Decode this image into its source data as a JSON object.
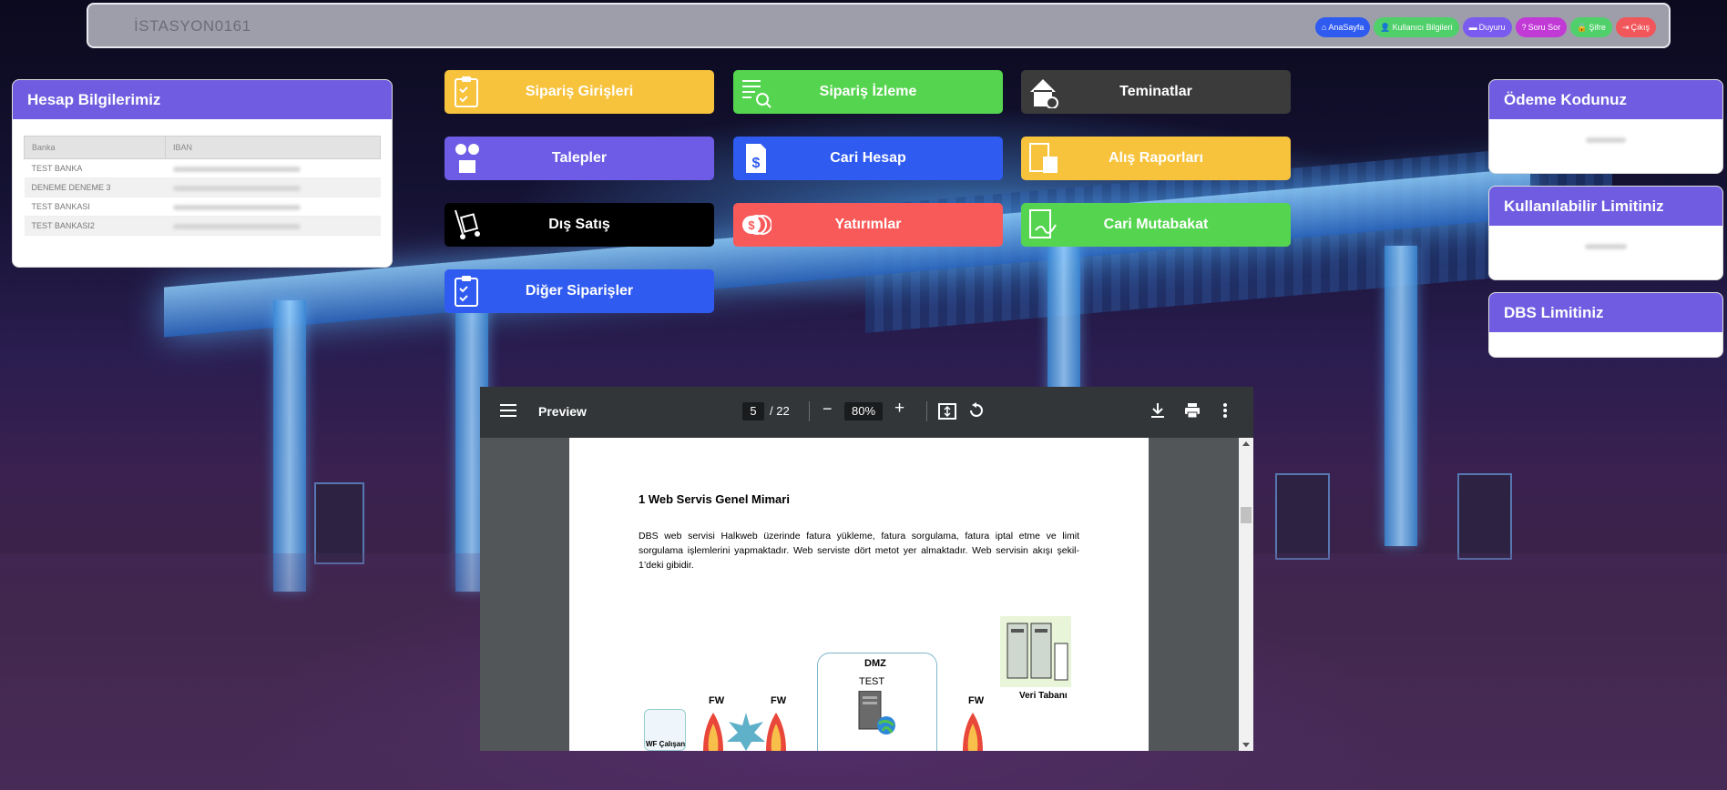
{
  "header": {
    "station": "İSTASYON0161",
    "nav": [
      {
        "label": "AnaSayfa",
        "icon": "home-icon",
        "color": "#2f5bf0"
      },
      {
        "label": "Kullanıcı Bilgileri",
        "icon": "user-icon",
        "color": "#4fd06a"
      },
      {
        "label": "Duyuru",
        "icon": "folder-icon",
        "color": "#7a5bf0"
      },
      {
        "label": "Soru Sor",
        "icon": "question-icon",
        "color": "#c13ad6"
      },
      {
        "label": "Şifre",
        "icon": "lock-icon",
        "color": "#4fd06a"
      },
      {
        "label": "Çıkış",
        "icon": "logout-icon",
        "color": "#f0565a"
      }
    ]
  },
  "account": {
    "title": "Hesap Bilgilerimiz",
    "columns": [
      "Banka",
      "IBAN"
    ],
    "rows": [
      {
        "bank": "TEST BANKA"
      },
      {
        "bank": "DENEME DENEME 3"
      },
      {
        "bank": "TEST BANKASI"
      },
      {
        "bank": "TEST BANKASI2"
      }
    ]
  },
  "menu": [
    {
      "label": "Sipariş Girişleri",
      "color": "#f7c23c",
      "icon": "clipboard-check-icon"
    },
    {
      "label": "Sipariş İzleme",
      "color": "#55d44f",
      "icon": "list-search-icon"
    },
    {
      "label": "Teminatlar",
      "color": "#3b3b3b",
      "icon": "house-check-icon"
    },
    {
      "label": "Talepler",
      "color": "#6e5ce6",
      "icon": "question-box-icon"
    },
    {
      "label": "Cari Hesap",
      "color": "#2f5bf0",
      "icon": "dollar-document-icon"
    },
    {
      "label": "Alış Raporları",
      "color": "#f7c23c",
      "icon": "calculator-report-icon"
    },
    {
      "label": "Dış Satış",
      "color": "#000000",
      "icon": "hand-truck-icon"
    },
    {
      "label": "Yatırımlar",
      "color": "#f85a5a",
      "icon": "coins-icon"
    },
    {
      "label": "Cari Mutabakat",
      "color": "#55d44f",
      "icon": "document-sign-icon"
    },
    {
      "label": "Diğer Siparişler",
      "color": "#2f5bf0",
      "icon": "clipboard-check-icon"
    }
  ],
  "right": [
    {
      "title": "Ödeme Kodunuz"
    },
    {
      "title": "Kullanılabilir Limitiniz"
    },
    {
      "title": "DBS Limitiniz"
    }
  ],
  "pdf": {
    "title": "Preview",
    "page": "5",
    "total": "/ 22",
    "zoom": "80%",
    "heading": "1    Web Servis Genel Mimari",
    "paragraph": "DBS web servisi Halkweb üzerinde fatura yükleme, fatura sorgulama, fatura iptal etme ve limit sorgulama işlemlerini yapmaktadır. Web serviste dört metot yer almaktadır. Web servisin akışı şekil-1’deki gibidir.",
    "diagram": {
      "fw1": "FW",
      "fw2": "FW",
      "fw3": "FW",
      "dmz": "DMZ",
      "test": "TEST",
      "db": "Veri Tabanı",
      "client": "WF Çalışan"
    }
  }
}
